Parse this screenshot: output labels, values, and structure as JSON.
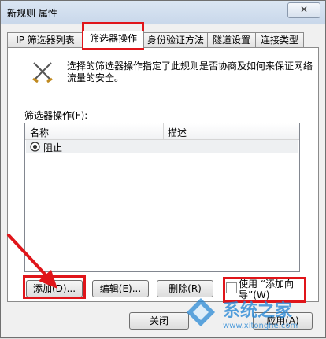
{
  "window": {
    "title": "新规则 属性",
    "close_label": "✕"
  },
  "tabs": [
    "IP 筛选器列表",
    "筛选器操作",
    "身份验证方法",
    "隧道设置",
    "连接类型"
  ],
  "description": "选择的筛选器操作指定了此规则是否协商及如何来保证网络流量的安全。",
  "list_label": "筛选器操作(F):",
  "columns": [
    "名称",
    "描述"
  ],
  "rows": [
    {
      "name": "阻止",
      "desc": ""
    }
  ],
  "buttons": {
    "add": "添加(D)...",
    "edit": "编辑(E)...",
    "remove": "删除(R)",
    "wizard": "使用 “添加向导”(W)",
    "close": "关闭",
    "apply": "应用(A)"
  },
  "watermark": {
    "brand": "系统之家",
    "url": "www.xitonghe.com"
  },
  "colors": {
    "highlight": "#e0151a",
    "brand": "#2a89d6"
  }
}
